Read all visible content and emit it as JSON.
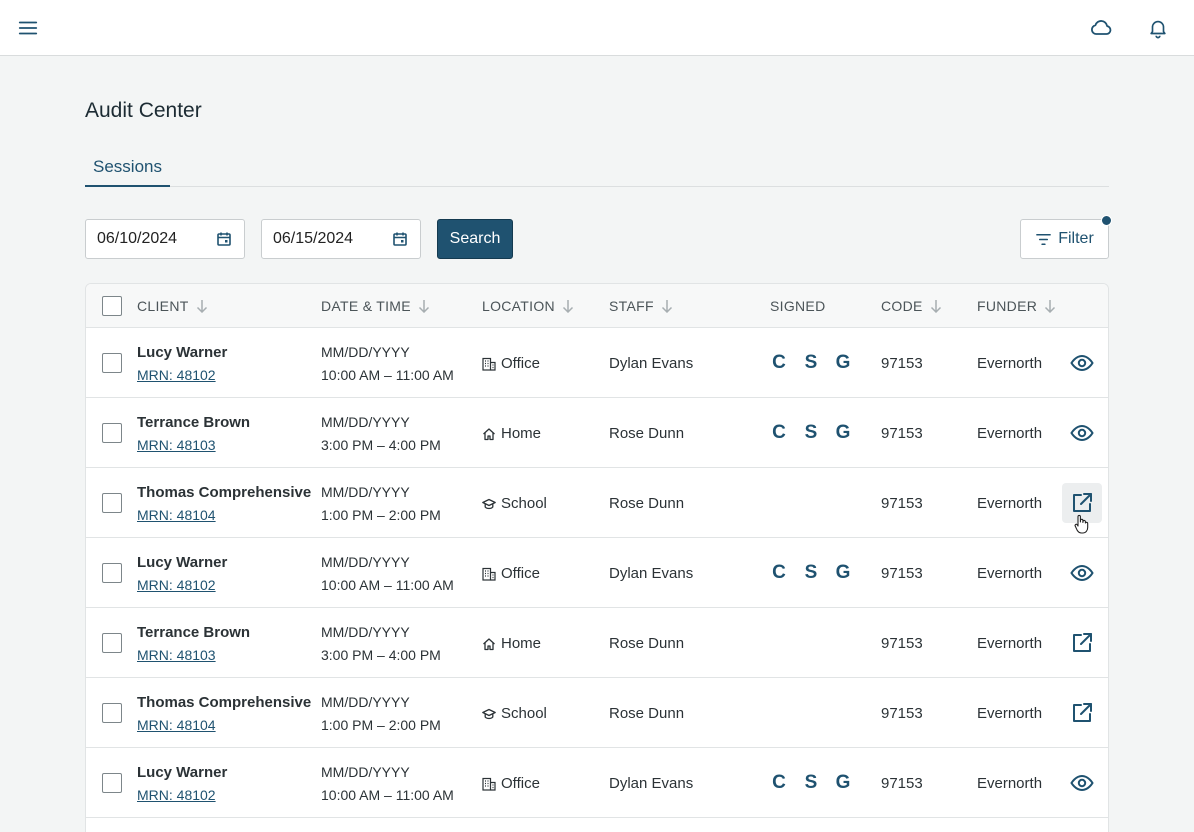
{
  "header": {
    "menu_icon": "menu-icon",
    "cloud_icon": "cloud-icon",
    "bell_icon": "bell-icon"
  },
  "page": {
    "title": "Audit Center",
    "tabs": [
      {
        "label": "Sessions"
      }
    ]
  },
  "toolbar": {
    "start_date": "06/10/2024",
    "end_date": "06/15/2024",
    "search_label": "Search",
    "filter_label": "Filter"
  },
  "table": {
    "columns": {
      "client": "CLIENT",
      "datetime": "DATE & TIME",
      "location": "LOCATION",
      "staff": "STAFF",
      "signed": "SIGNED",
      "code": "CODE",
      "funder": "FUNDER"
    },
    "rows": [
      {
        "client": "Lucy Warner",
        "mrn": "MRN: 48102",
        "date": "MM/DD/YYYY",
        "time": "10:00 AM – 11:00 AM",
        "location": "Office",
        "location_icon": "building-icon",
        "staff": "Dylan Evans",
        "signed": [
          "C",
          "S",
          "G"
        ],
        "code": "97153",
        "funder": "Evernorth",
        "action": "view-icon"
      },
      {
        "client": "Terrance Brown",
        "mrn": "MRN: 48103",
        "date": "MM/DD/YYYY",
        "time": "3:00 PM – 4:00 PM",
        "location": "Home",
        "location_icon": "home-icon",
        "staff": "Rose Dunn",
        "signed": [
          "C",
          "S",
          "G"
        ],
        "code": "97153",
        "funder": "Evernorth",
        "action": "view-icon"
      },
      {
        "client": "Thomas Comprehensive",
        "mrn": "MRN: 48104",
        "date": "MM/DD/YYYY",
        "time": "1:00 PM – 2:00 PM",
        "location": "School",
        "location_icon": "school-icon",
        "staff": "Rose Dunn",
        "signed": [],
        "code": "97153",
        "funder": "Evernorth",
        "action": "open-external-icon"
      },
      {
        "client": "Lucy Warner",
        "mrn": "MRN: 48102",
        "date": "MM/DD/YYYY",
        "time": "10:00 AM – 11:00 AM",
        "location": "Office",
        "location_icon": "building-icon",
        "staff": "Dylan Evans",
        "signed": [
          "C",
          "S",
          "G"
        ],
        "code": "97153",
        "funder": "Evernorth",
        "action": "view-icon"
      },
      {
        "client": "Terrance Brown",
        "mrn": "MRN: 48103",
        "date": "MM/DD/YYYY",
        "time": "3:00 PM – 4:00 PM",
        "location": "Home",
        "location_icon": "home-icon",
        "staff": "Rose Dunn",
        "signed": [],
        "code": "97153",
        "funder": "Evernorth",
        "action": "open-external-icon"
      },
      {
        "client": "Thomas Comprehensive",
        "mrn": "MRN: 48104",
        "date": "MM/DD/YYYY",
        "time": "1:00 PM – 2:00 PM",
        "location": "School",
        "location_icon": "school-icon",
        "staff": "Rose Dunn",
        "signed": [],
        "code": "97153",
        "funder": "Evernorth",
        "action": "open-external-icon"
      },
      {
        "client": "Lucy Warner",
        "mrn": "MRN: 48102",
        "date": "MM/DD/YYYY",
        "time": "10:00 AM – 11:00 AM",
        "location": "Office",
        "location_icon": "building-icon",
        "staff": "Dylan Evans",
        "signed": [
          "C",
          "S",
          "G"
        ],
        "code": "97153",
        "funder": "Evernorth",
        "action": "view-icon"
      }
    ]
  },
  "colors": {
    "primary": "#1f5270",
    "background": "#f3f5f5"
  }
}
